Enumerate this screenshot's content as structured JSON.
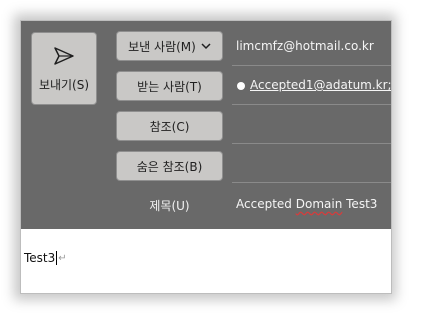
{
  "send": {
    "label": "보내기(S)",
    "icon": "send-icon"
  },
  "buttons": {
    "from": "보낸 사람(M)",
    "to": "받는 사람(T)",
    "cc": "참조(C)",
    "bcc": "숨은 참조(B)"
  },
  "fields": {
    "from_value": "limcmfz@hotmail.co.kr",
    "to_recipient": "Accepted1@adatum.kr;",
    "subject_label": "제목(U)",
    "subject_word1": "Accepted",
    "subject_word2": "Domain",
    "subject_word3": "Test3"
  },
  "body": {
    "text": "Test3",
    "paragraph_mark": "↵"
  },
  "colors": {
    "header_bg": "#696969",
    "button_bg": "#c9c8c6",
    "text_light": "#f5f5f5"
  }
}
